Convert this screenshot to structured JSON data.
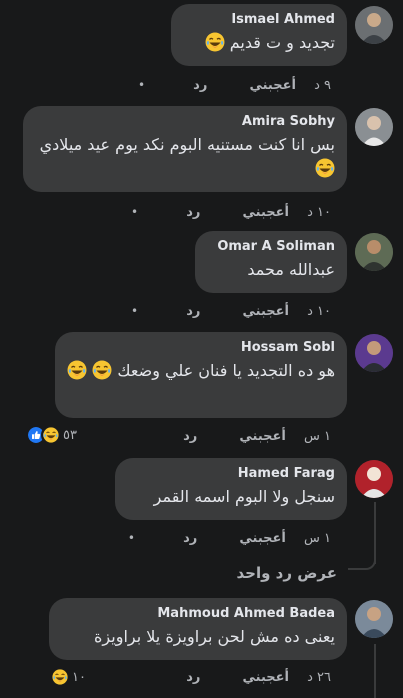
{
  "comments": [
    {
      "author": "Ismael Ahmed",
      "text": "تجديد و ت قديم",
      "time": "٩ د",
      "like": "أعجبني",
      "reply": "رد",
      "more": "•"
    },
    {
      "author": "Amira Sobhy",
      "text": "بس انا كنت مستنيه البوم نكد يوم عيد ميلادي",
      "time": "١٠ د",
      "like": "أعجبني",
      "reply": "رد",
      "more": "•"
    },
    {
      "author": "Omar A Soliman",
      "text": "عبدالله محمد",
      "time": "١٠ د",
      "like": "أعجبني",
      "reply": "رد",
      "more": "•"
    },
    {
      "author": "Hossam Sobl",
      "text": "هو ده التجديد يا فنان علي وضعك",
      "time": "١ س",
      "like": "أعجبني",
      "reply": "رد",
      "reaction_count": "٥٣"
    },
    {
      "author": "Hamed Farag",
      "text": "سنجل ولا البوم اسمه القمر",
      "time": "١ س",
      "like": "أعجبني",
      "reply": "رد",
      "more": "•"
    },
    {
      "author": "Mahmoud Ahmed Badea",
      "text": "يعنى ده مش لحن براويزة يلا براويزة",
      "time": "٢٦ د",
      "like": "أعجبني",
      "reply": "رد",
      "reaction_count": "١٠"
    }
  ],
  "view_replies": "عرض رد واحد",
  "icons": {
    "laugh": "laughing-emoji-icon",
    "like": "like-reaction-icon"
  },
  "colors": {
    "background": "#18191a",
    "bubble": "#3a3b3c",
    "secondary_text": "#b0b3b8",
    "like_blue": "#2078f4",
    "emoji_yellow": "#f7c531"
  }
}
